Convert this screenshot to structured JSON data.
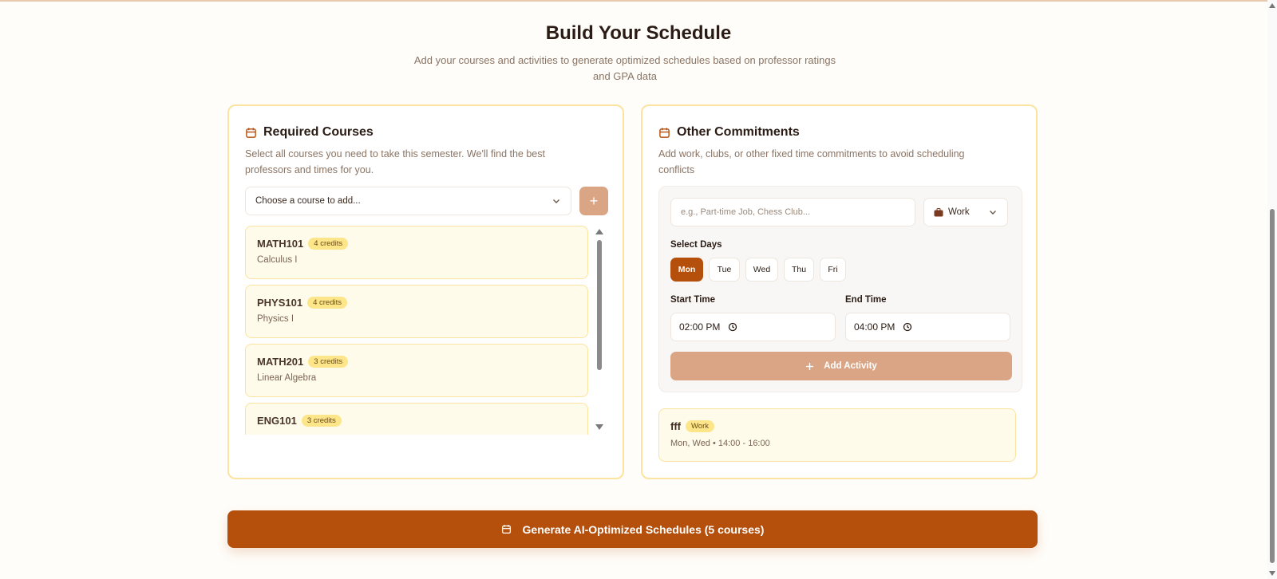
{
  "header": {
    "title": "Build Your Schedule",
    "subtitle": "Add your courses and activities to generate optimized schedules based on professor ratings and GPA data"
  },
  "courses_card": {
    "title": "Required Courses",
    "description": "Select all courses you need to take this semester. We'll find the best professors and times for you.",
    "select_placeholder": "Choose a course to add...",
    "add_button": "+",
    "items": [
      {
        "code": "MATH101",
        "credits": "4 credits",
        "name": "Calculus I"
      },
      {
        "code": "PHYS101",
        "credits": "4 credits",
        "name": "Physics I"
      },
      {
        "code": "MATH201",
        "credits": "3 credits",
        "name": "Linear Algebra"
      },
      {
        "code": "ENG101",
        "credits": "3 credits",
        "name": ""
      }
    ]
  },
  "commitments_card": {
    "title": "Other Commitments",
    "description": "Add work, clubs, or other fixed time commitments to avoid scheduling conflicts",
    "activity_placeholder": "e.g., Part-time Job, Chess Club...",
    "type_select": {
      "value": "Work",
      "icon": "briefcase-icon"
    },
    "select_days_label": "Select Days",
    "days": [
      {
        "label": "Mon",
        "active": true
      },
      {
        "label": "Tue",
        "active": false
      },
      {
        "label": "Wed",
        "active": false
      },
      {
        "label": "Thu",
        "active": false
      },
      {
        "label": "Fri",
        "active": false
      }
    ],
    "start_time_label": "Start Time",
    "start_time": "02:00 PM",
    "end_time_label": "End Time",
    "end_time": "04:00 PM",
    "add_activity_button": "Add Activity",
    "activities": [
      {
        "name": "fff",
        "type": "Work",
        "meta": "Mon, Wed • 14:00 - 16:00"
      }
    ]
  },
  "generate_button": "Generate AI-Optimized Schedules (5 courses)",
  "colors": {
    "accent": "#b5500c",
    "accent_light": "#d9a585",
    "card_border": "#fde3a0",
    "item_bg": "#fffbea",
    "badge_bg": "#fde58a"
  }
}
